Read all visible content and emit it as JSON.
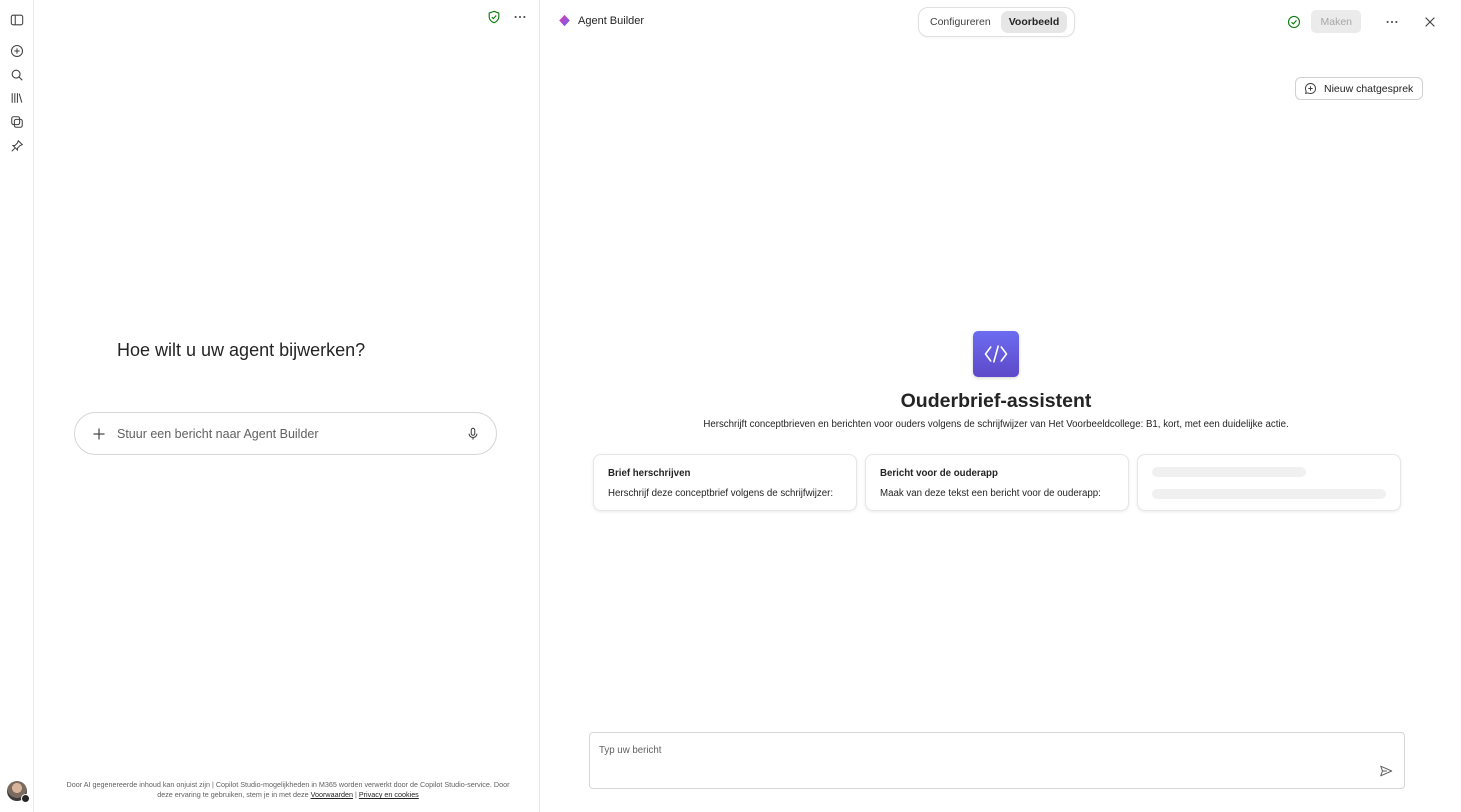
{
  "left_pane": {
    "heading": "Hoe wilt u uw agent bijwerken?",
    "composer_placeholder": "Stuur een bericht naar Agent Builder",
    "disclaimer": {
      "text": "Door AI gegenereerde inhoud kan onjuist zijn | Copilot Studio-mogelijkheden in M365 worden verwerkt door de Copilot Studio-service. Door deze ervaring te gebruiken, stem je in met deze",
      "terms_link": "Voorwaarden",
      "separator": "|",
      "privacy_link": "Privacy en cookies"
    }
  },
  "header": {
    "app_name": "Agent Builder",
    "tabs": [
      {
        "label": "Configureren",
        "active": false
      },
      {
        "label": "Voorbeeld",
        "active": true
      }
    ],
    "create_button": "Maken"
  },
  "preview": {
    "new_chat_button": "Nieuw chatgesprek",
    "agent_name": "Ouderbrief-assistent",
    "agent_description": "Herschrijft conceptbrieven en berichten voor ouders volgens de schrijfwijzer van Het Voorbeeldcollege: B1, kort, met een duidelijke actie.",
    "starters": [
      {
        "title": "Brief herschrijven",
        "prompt": "Herschrijf deze conceptbrief volgens de schrijfwijzer:"
      },
      {
        "title": "Bericht voor de ouderapp",
        "prompt": "Maak van deze tekst een bericht voor de ouderapp:"
      }
    ],
    "input_placeholder": "Typ uw bericht"
  },
  "colors": {
    "accent_purple": "#5d49c9",
    "success_green": "#107c10",
    "disabled_bg": "#ebebeb"
  },
  "icons": {
    "rail": [
      "sidebar-toggle-icon",
      "new-chat-icon",
      "search-icon",
      "library-icon",
      "agents-icon",
      "pin-icon"
    ],
    "left_top": [
      "shield-check-icon",
      "more-icon"
    ],
    "right_top": [
      "check-circle-icon",
      "more-icon",
      "close-icon"
    ]
  }
}
